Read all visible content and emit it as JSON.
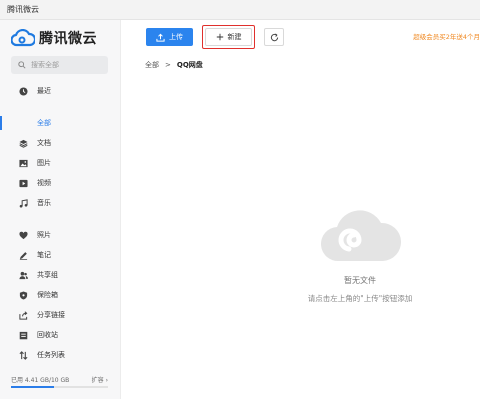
{
  "window": {
    "title": "腾讯微云"
  },
  "sidebar": {
    "logo_text": "腾讯微云",
    "search_placeholder": "搜索全部",
    "items": [
      {
        "label": "最近",
        "icon": "clock-icon"
      },
      {
        "label": "全部",
        "icon": "list-icon",
        "active": true
      },
      {
        "label": "文档",
        "icon": "layers-icon"
      },
      {
        "label": "图片",
        "icon": "image-icon"
      },
      {
        "label": "视频",
        "icon": "video-icon"
      },
      {
        "label": "音乐",
        "icon": "music-icon"
      },
      {
        "label": "照片",
        "icon": "heart-icon"
      },
      {
        "label": "笔记",
        "icon": "pen-icon"
      },
      {
        "label": "共享组",
        "icon": "people-icon"
      },
      {
        "label": "保险箱",
        "icon": "shield-icon"
      },
      {
        "label": "分享链接",
        "icon": "share-icon"
      },
      {
        "label": "回收站",
        "icon": "trash-icon"
      },
      {
        "label": "任务列表",
        "icon": "transfer-icon"
      }
    ],
    "storage": {
      "used_text": "已用 4.41 GB/10 GB",
      "expand_label": "扩容",
      "used_fraction": 0.441
    }
  },
  "toolbar": {
    "upload_label": "上传",
    "new_label": "新建",
    "promo_text": "超级会员买2年送4个月"
  },
  "breadcrumb": {
    "root": "全部",
    "separator": ">",
    "current": "QQ网盘"
  },
  "empty_state": {
    "title": "暂无文件",
    "hint": "请点击左上角的\"上传\"按钮添加"
  },
  "colors": {
    "accent": "#2b84ee",
    "highlight": "#e0302c",
    "promo": "#f08a24"
  }
}
